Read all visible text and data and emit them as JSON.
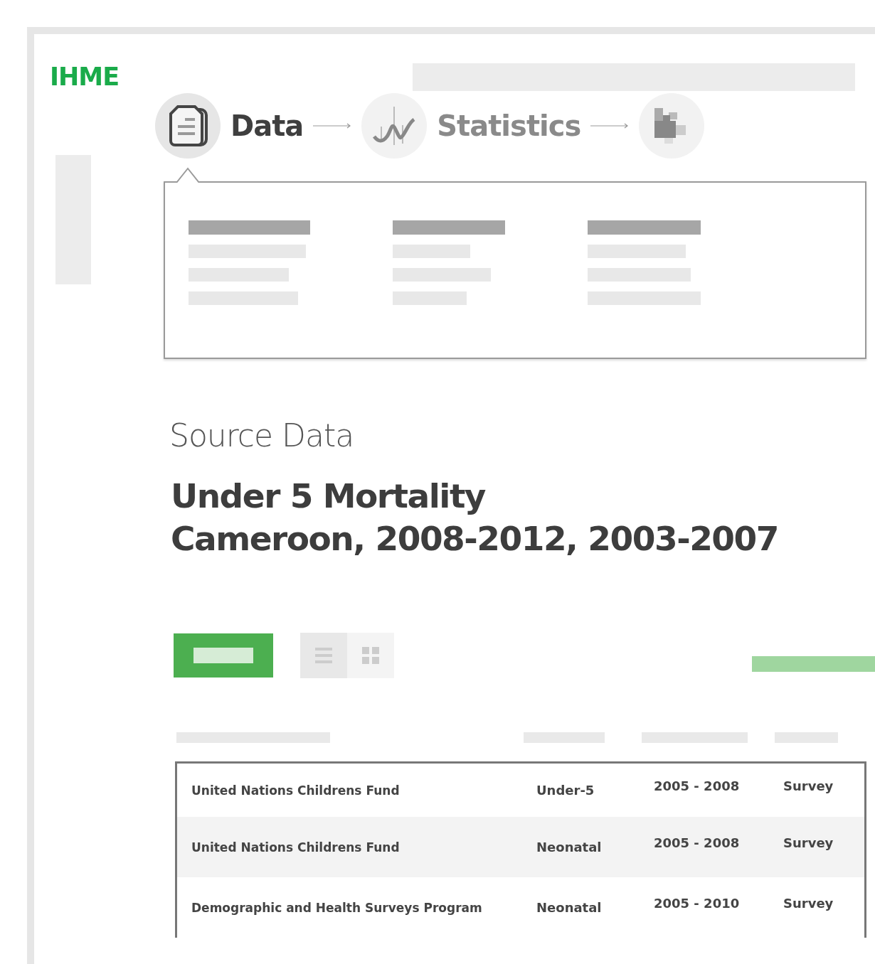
{
  "logo": "IHME",
  "steps": [
    {
      "kind": "document",
      "label": "Data",
      "selected": true
    },
    {
      "kind": "chart",
      "label": "Statistics",
      "selected": false
    },
    {
      "kind": "map",
      "selected": false
    }
  ],
  "section_label": "Source Data",
  "title_lines": [
    "Under 5 Mortality",
    "Cameroon, 2008-2012, 2003-2007"
  ],
  "view_toggle": [
    {
      "kind": "list",
      "selected": true
    },
    {
      "kind": "grid",
      "selected": false
    }
  ],
  "table": {
    "rows": [
      {
        "cells": [
          "United Nations Childrens Fund",
          "Under-5",
          "2005 - 2008",
          "Survey"
        ],
        "shaded": false
      },
      {
        "cells": [
          "United Nations Childrens Fund",
          "Neonatal",
          "2005 - 2008",
          "Survey"
        ],
        "shaded": true
      },
      {
        "cells": [
          "Demographic and Health Surveys Program",
          "Neonatal",
          "2005 - 2010",
          "Survey"
        ],
        "shaded": false
      }
    ]
  }
}
